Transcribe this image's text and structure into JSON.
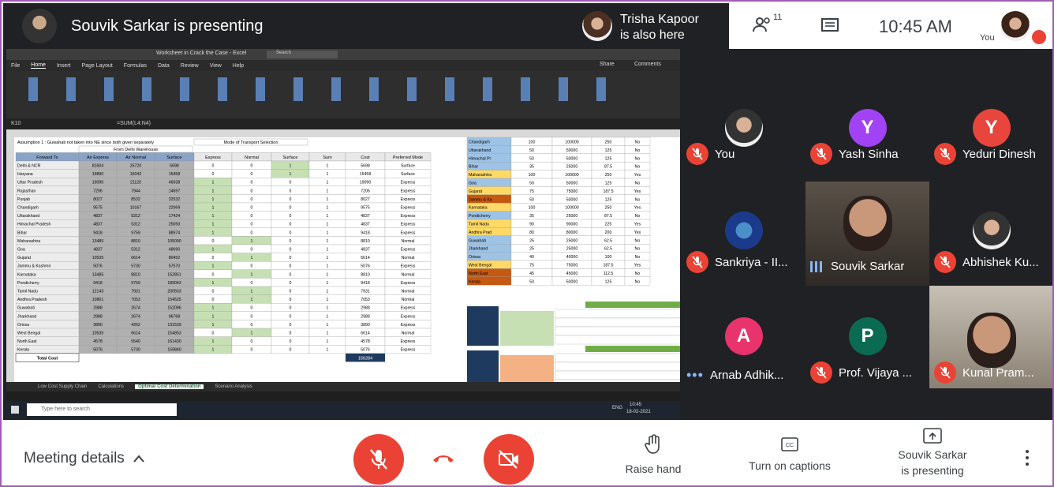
{
  "header": {
    "presenter_text": "Souvik Sarkar is presenting",
    "also_here_name": "Trisha Kapoor",
    "also_here_text": "is also here",
    "participants_count": "11",
    "time": "10:45 AM",
    "you_label": "You"
  },
  "excel": {
    "file_title": "Worksheet in Crack the Case - Excel",
    "search_placeholder": "Search",
    "ribbon_tabs": [
      "File",
      "Home",
      "Insert",
      "Page Layout",
      "Formulas",
      "Data",
      "Review",
      "View",
      "Help"
    ],
    "share_label": "Share",
    "comments_label": "Comments",
    "cell_ref": "K10",
    "formula": "=SUM(L4:N4)",
    "assumption_text": "Assumption 1 : Guwahati not taken into NE since both given separately",
    "group_header_1": "From Delhi Warehouse",
    "group_header_2": "Mode of Transport Selection",
    "columns": [
      "Forward To",
      "Air Express",
      "Air Normal",
      "Surface",
      "Express",
      "Normal",
      "Surface",
      "Sum",
      "Cost",
      "Preferred Mode"
    ],
    "rows": [
      [
        "Delhi & NCR",
        "81604",
        "25720",
        "5698",
        "0",
        "0",
        "1",
        "1",
        "5698",
        "Surface"
      ],
      [
        "Haryana",
        "19890",
        "16042",
        "15458",
        "0",
        "0",
        "1",
        "1",
        "15458",
        "Surface"
      ],
      [
        "Uttar Pradesh",
        "19090",
        "21120",
        "46938",
        "1",
        "0",
        "0",
        "1",
        "19090",
        "Express"
      ],
      [
        "Rajasthan",
        "7206",
        "7944",
        "14697",
        "1",
        "0",
        "0",
        "1",
        "7206",
        "Express"
      ],
      [
        "Punjab",
        "8027",
        "8532",
        "32532",
        "1",
        "0",
        "0",
        "1",
        "8027",
        "Express"
      ],
      [
        "Chandigarh",
        "9575",
        "10167",
        "22069",
        "1",
        "0",
        "0",
        "1",
        "9575",
        "Express"
      ],
      [
        "Uttarakhand",
        "4837",
        "5312",
        "17424",
        "1",
        "0",
        "0",
        "1",
        "4837",
        "Express"
      ],
      [
        "Himachal Pradesh",
        "4837",
        "5312",
        "25093",
        "1",
        "0",
        "0",
        "1",
        "4837",
        "Express"
      ],
      [
        "Bihar",
        "9418",
        "9759",
        "88974",
        "1",
        "0",
        "0",
        "1",
        "9418",
        "Express"
      ],
      [
        "Maharashtra",
        "13485",
        "8810",
        "105090",
        "0",
        "1",
        "0",
        "1",
        "8810",
        "Normal"
      ],
      [
        "Goa",
        "4837",
        "5312",
        "48690",
        "1",
        "0",
        "0",
        "1",
        "4837",
        "Express"
      ],
      [
        "Gujarat",
        "10535",
        "6614",
        "80452",
        "0",
        "1",
        "0",
        "1",
        "6614",
        "Normal"
      ],
      [
        "Jammu & Kashmir",
        "5076",
        "5730",
        "57570",
        "1",
        "0",
        "0",
        "1",
        "5076",
        "Express"
      ],
      [
        "Karnataka",
        "13485",
        "8810",
        "152851",
        "0",
        "1",
        "0",
        "1",
        "8810",
        "Normal"
      ],
      [
        "Pondicherry",
        "9418",
        "9759",
        "189043",
        "1",
        "0",
        "0",
        "1",
        "9418",
        "Express"
      ],
      [
        "Tamil Nadu",
        "12143",
        "7931",
        "200553",
        "0",
        "1",
        "0",
        "1",
        "7931",
        "Normal"
      ],
      [
        "Andhra Pradesh",
        "10801",
        "7053",
        "154525",
        "0",
        "1",
        "0",
        "1",
        "7053",
        "Normal"
      ],
      [
        "Guwahati",
        "2988",
        "2674",
        "152096",
        "1",
        "0",
        "0",
        "1",
        "2988",
        "Express"
      ],
      [
        "Jharkhand",
        "2988",
        "2674",
        "96768",
        "1",
        "0",
        "0",
        "1",
        "2988",
        "Express"
      ],
      [
        "Orissa",
        "3890",
        "4262",
        "131539",
        "1",
        "0",
        "0",
        "1",
        "3890",
        "Express"
      ],
      [
        "West Bengal",
        "10535",
        "6614",
        "154853",
        "0",
        "1",
        "0",
        "1",
        "6614",
        "Normal"
      ],
      [
        "North East",
        "4578",
        "5540",
        "161430",
        "1",
        "0",
        "0",
        "1",
        "4578",
        "Express"
      ],
      [
        "Kerala",
        "5076",
        "5730",
        "159840",
        "1",
        "0",
        "0",
        "1",
        "5076",
        "Express"
      ]
    ],
    "total_label": "Total Cost",
    "total_value": "156284",
    "right_table": [
      [
        "Chandigarh",
        "100",
        "100000",
        "250",
        "No"
      ],
      [
        "Uttarakhand",
        "50",
        "50000",
        "125",
        "No"
      ],
      [
        "Himachal Pr",
        "50",
        "50000",
        "125",
        "No"
      ],
      [
        "Bihar",
        "35",
        "25000",
        "87.5",
        "No"
      ],
      [
        "Maharashtra",
        "100",
        "100000",
        "250",
        "Yes"
      ],
      [
        "Goa",
        "50",
        "50000",
        "125",
        "No"
      ],
      [
        "Gujarat",
        "75",
        "75000",
        "187.5",
        "Yes"
      ],
      [
        "Jammu & Ka",
        "50",
        "50000",
        "125",
        "No"
      ],
      [
        "Karnataka",
        "100",
        "100000",
        "250",
        "Yes"
      ],
      [
        "Pondicherry",
        "35",
        "25000",
        "87.5",
        "No"
      ],
      [
        "Tamil Nadu",
        "90",
        "90000",
        "225",
        "Yes"
      ],
      [
        "Andhra Prad",
        "80",
        "80000",
        "200",
        "Yes"
      ],
      [
        "Guwahati",
        "25",
        "25000",
        "62.5",
        "No"
      ],
      [
        "Jharkhand",
        "25",
        "25000",
        "62.5",
        "No"
      ],
      [
        "Orissa",
        "40",
        "40000",
        "100",
        "No"
      ],
      [
        "West Bengal",
        "75",
        "75000",
        "187.5",
        "Yes"
      ],
      [
        "North East",
        "45",
        "45000",
        "112.5",
        "No"
      ],
      [
        "Kerala",
        "50",
        "50000",
        "125",
        "No"
      ]
    ],
    "sheet_tabs": [
      "Low Cost Supply Chain",
      "Calculations",
      "Optimal Cost Determination",
      "Scenario Analysis"
    ],
    "active_sheet": "Optimal Cost Determination",
    "taskbar_search": "Type here to search",
    "taskbar_time": "10:45",
    "taskbar_date": "18-02-2021",
    "taskbar_lang": "ENG"
  },
  "participants": [
    {
      "name": "You",
      "initial": "",
      "color": "#ffffff",
      "muted": true,
      "photo": true
    },
    {
      "name": "Yash Sinha",
      "initial": "Y",
      "color": "#a142f4",
      "muted": true
    },
    {
      "name": "Yeduri Dinesh",
      "initial": "Y",
      "color": "#e8453c",
      "muted": true
    },
    {
      "name": "Sankriya - II...",
      "initial": "",
      "color": "#1b3a8c",
      "muted": true,
      "photo": true
    },
    {
      "name": "Souvik Sarkar",
      "initial": "",
      "color": "#333",
      "muted": false,
      "video": true
    },
    {
      "name": "Abhishek Ku...",
      "initial": "",
      "color": "#ffffff",
      "muted": true,
      "photo": true
    },
    {
      "name": "Arnab Adhik...",
      "initial": "A",
      "color": "#e8336c",
      "muted": false
    },
    {
      "name": "Prof. Vijaya ...",
      "initial": "P",
      "color": "#0b6b52",
      "muted": true
    },
    {
      "name": "Kunal Pram...",
      "initial": "",
      "color": "#555",
      "muted": true,
      "video": true
    }
  ],
  "bottom": {
    "meeting_details": "Meeting details",
    "raise_hand": "Raise hand",
    "captions": "Turn on captions",
    "presenting_line1": "Souvik Sarkar",
    "presenting_line2": "is presenting"
  },
  "colors": {
    "accent_red": "#ea4335",
    "frame": "#a35cb6",
    "dark_bg": "#202124"
  }
}
